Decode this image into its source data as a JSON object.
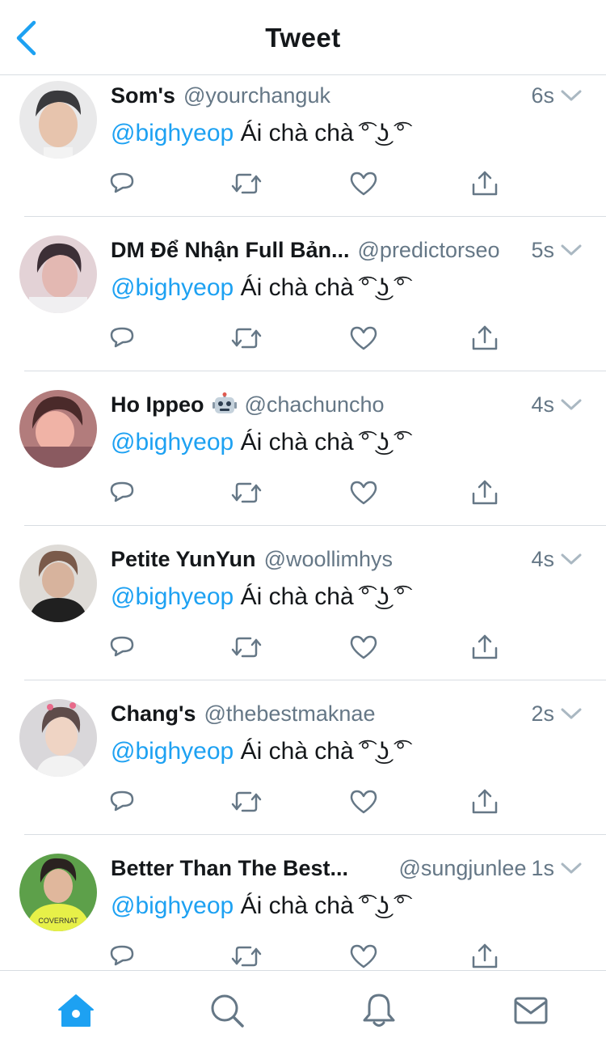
{
  "header": {
    "title": "Tweet",
    "back_icon": "chevron-left-icon",
    "accent": "#1da1f2"
  },
  "tweets": [
    {
      "name": "Som's",
      "handle": "@yourchanguk",
      "time": "6s",
      "mention": "@bighyeop",
      "text": "Ái chà chà ͡° ͜ʖ ͡°",
      "avatar_colors": [
        "#e9e9ea",
        "#3a3a3d",
        "#e7c4ad"
      ]
    },
    {
      "name": "DM Để Nhận Full Bản...",
      "handle": "@predictorseo",
      "time": "5s",
      "mention": "@bighyeop",
      "text": "Ái chà chà ͡° ͜ʖ ͡°",
      "avatar_colors": [
        "#e3d2d6",
        "#3c2f36",
        "#e3b8b2"
      ]
    },
    {
      "name": "Ho Ippeo",
      "name_emoji": "robot-face-icon",
      "handle": "@chachuncho",
      "time": "4s",
      "mention": "@bighyeop",
      "text": "Ái chà chà ͡° ͜ʖ ͡°",
      "avatar_colors": [
        "#b27c7c",
        "#4a2a2a",
        "#f0b3a6"
      ]
    },
    {
      "name": "Petite YunYun",
      "handle": "@woollimhys",
      "time": "4s",
      "mention": "@bighyeop",
      "text": "Ái chà chà ͡° ͜ʖ ͡°",
      "avatar_colors": [
        "#dedbd7",
        "#202020",
        "#d7b39d"
      ]
    },
    {
      "name": "Chang's",
      "handle": "@thebestmaknae",
      "time": "2s",
      "mention": "@bighyeop",
      "text": "Ái chà chà ͡° ͜ʖ ͡°",
      "avatar_colors": [
        "#d9d7da",
        "#5e4c4a",
        "#efd4c4"
      ]
    },
    {
      "name": "Better Than The Best...",
      "handle": "@sungjunlee",
      "time": "1s",
      "mention": "@bighyeop",
      "text": "Ái chà chà ͡° ͜ʖ ͡°",
      "avatar_colors": [
        "#5da04a",
        "#e7f048",
        "#e0b79c"
      ]
    }
  ],
  "actions": {
    "reply": "reply-icon",
    "retweet": "retweet-icon",
    "like": "heart-icon",
    "share": "share-icon"
  },
  "tabbar": {
    "items": [
      {
        "icon": "home-icon",
        "active": true
      },
      {
        "icon": "search-icon",
        "active": false
      },
      {
        "icon": "bell-icon",
        "active": false
      },
      {
        "icon": "mail-icon",
        "active": false
      }
    ],
    "active_color": "#1da1f2",
    "inactive_color": "#657786"
  }
}
